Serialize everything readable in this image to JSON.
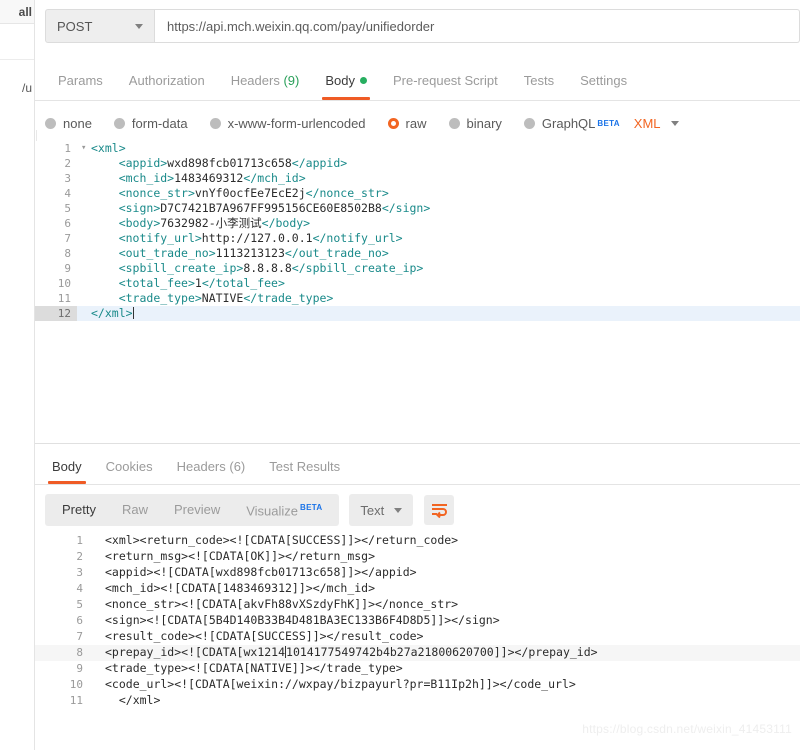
{
  "left_panel": {
    "fragment_top": "all",
    "fragment_mid": "/u"
  },
  "request": {
    "method": "POST",
    "url": "https://api.mch.weixin.qq.com/pay/unifiedorder",
    "tabs": [
      {
        "label": "Params",
        "active": false,
        "count": "",
        "dot": false
      },
      {
        "label": "Authorization",
        "active": false,
        "count": "",
        "dot": false
      },
      {
        "label": "Headers",
        "active": false,
        "count": "(9)",
        "dot": false
      },
      {
        "label": "Body",
        "active": true,
        "count": "",
        "dot": true
      },
      {
        "label": "Pre-request Script",
        "active": false,
        "count": "",
        "dot": false
      },
      {
        "label": "Tests",
        "active": false,
        "count": "",
        "dot": false
      },
      {
        "label": "Settings",
        "active": false,
        "count": "",
        "dot": false
      }
    ],
    "body_types": [
      {
        "label": "none",
        "selected": false
      },
      {
        "label": "form-data",
        "selected": false
      },
      {
        "label": "x-www-form-urlencoded",
        "selected": false
      },
      {
        "label": "raw",
        "selected": true
      },
      {
        "label": "binary",
        "selected": false
      },
      {
        "label": "GraphQL",
        "selected": false,
        "badge": "BETA"
      }
    ],
    "raw_format": "XML",
    "body_lines": [
      {
        "n": "1",
        "indent": 0,
        "fold": "▾",
        "tag_open": "<xml>",
        "text": "",
        "tag_close": "",
        "selected": false
      },
      {
        "n": "2",
        "indent": 1,
        "fold": "",
        "tag_open": "<appid>",
        "text": "wxd898fcb01713c658",
        "tag_close": "</appid>",
        "selected": false
      },
      {
        "n": "3",
        "indent": 1,
        "fold": "",
        "tag_open": "<mch_id>",
        "text": "1483469312",
        "tag_close": "</mch_id>",
        "selected": false
      },
      {
        "n": "4",
        "indent": 1,
        "fold": "",
        "tag_open": "<nonce_str>",
        "text": "vnYf0ocfEe7EcE2j",
        "tag_close": "</nonce_str>",
        "selected": false
      },
      {
        "n": "5",
        "indent": 1,
        "fold": "",
        "tag_open": "<sign>",
        "text": "D7C7421B7A967FF995156CE60E8502B8",
        "tag_close": "</sign>",
        "selected": false
      },
      {
        "n": "6",
        "indent": 1,
        "fold": "",
        "tag_open": "<body>",
        "text": "7632982-小李测试",
        "tag_close": "</body>",
        "selected": false
      },
      {
        "n": "7",
        "indent": 1,
        "fold": "",
        "tag_open": "<notify_url>",
        "text": "http://127.0.0.1",
        "tag_close": "</notify_url>",
        "selected": false
      },
      {
        "n": "8",
        "indent": 1,
        "fold": "",
        "tag_open": "<out_trade_no>",
        "text": "1113213123",
        "tag_close": "</out_trade_no>",
        "selected": false
      },
      {
        "n": "9",
        "indent": 1,
        "fold": "",
        "tag_open": "<spbill_create_ip>",
        "text": "8.8.8.8",
        "tag_close": "</spbill_create_ip>",
        "selected": false
      },
      {
        "n": "10",
        "indent": 1,
        "fold": "",
        "tag_open": "<total_fee>",
        "text": "1",
        "tag_close": "</total_fee>",
        "selected": false
      },
      {
        "n": "11",
        "indent": 1,
        "fold": "",
        "tag_open": "<trade_type>",
        "text": "NATIVE",
        "tag_close": "</trade_type>",
        "selected": false
      },
      {
        "n": "12",
        "indent": 0,
        "fold": "",
        "tag_open": "</xml>",
        "text": "",
        "tag_close": "",
        "selected": true,
        "caret_after": true
      }
    ]
  },
  "response": {
    "tabs": [
      {
        "label": "Body",
        "active": true,
        "count": ""
      },
      {
        "label": "Cookies",
        "active": false,
        "count": ""
      },
      {
        "label": "Headers",
        "active": false,
        "count": "(6)"
      },
      {
        "label": "Test Results",
        "active": false,
        "count": ""
      }
    ],
    "view_modes": [
      {
        "label": "Pretty",
        "active": true
      },
      {
        "label": "Raw",
        "active": false
      },
      {
        "label": "Preview",
        "active": false
      },
      {
        "label": "Visualize",
        "active": false,
        "badge": "BETA"
      }
    ],
    "format": "Text",
    "wrap_icon": "word-wrap-icon",
    "body_lines": [
      {
        "n": "1",
        "indent": 0,
        "text": "<xml><return_code><![CDATA[SUCCESS]]></return_code>",
        "cursor": false
      },
      {
        "n": "2",
        "indent": 0,
        "text": "<return_msg><![CDATA[OK]]></return_msg>",
        "cursor": false
      },
      {
        "n": "3",
        "indent": 0,
        "text": "<appid><![CDATA[wxd898fcb01713c658]]></appid>",
        "cursor": false
      },
      {
        "n": "4",
        "indent": 0,
        "text": "<mch_id><![CDATA[1483469312]]></mch_id>",
        "cursor": false
      },
      {
        "n": "5",
        "indent": 0,
        "text": "<nonce_str><![CDATA[akvFh88vXSzdyFhK]]></nonce_str>",
        "cursor": false
      },
      {
        "n": "6",
        "indent": 0,
        "text": "<sign><![CDATA[5B4D140B33B4D481BA3EC133B6F4D8D5]]></sign>",
        "cursor": false
      },
      {
        "n": "7",
        "indent": 0,
        "text": "<result_code><![CDATA[SUCCESS]]></result_code>",
        "cursor": false
      },
      {
        "n": "8",
        "indent": 0,
        "text": "<prepay_id><![CDATA[wx12141014177549742b4b27a21800620700]]></prepay_id>",
        "cursor": true,
        "cursor_at": 26
      },
      {
        "n": "9",
        "indent": 0,
        "text": "<trade_type><![CDATA[NATIVE]]></trade_type>",
        "cursor": false
      },
      {
        "n": "10",
        "indent": 0,
        "text": "<code_url><![CDATA[weixin://wxpay/bizpayurl?pr=B11Ip2h]]></code_url>",
        "cursor": false
      },
      {
        "n": "11",
        "indent": 1,
        "text": "</xml>",
        "cursor": false
      }
    ]
  },
  "watermark": "https://blog.csdn.net/weixin_41453111",
  "colors": {
    "accent_orange": "#ef5b25",
    "radio_selected": "#f26522",
    "dot_green": "#27ae60",
    "count_green": "#2aa05a",
    "beta_blue": "#1a73e8",
    "tag_teal": "#1a8a8a",
    "selected_line": "#eaf2fb"
  }
}
